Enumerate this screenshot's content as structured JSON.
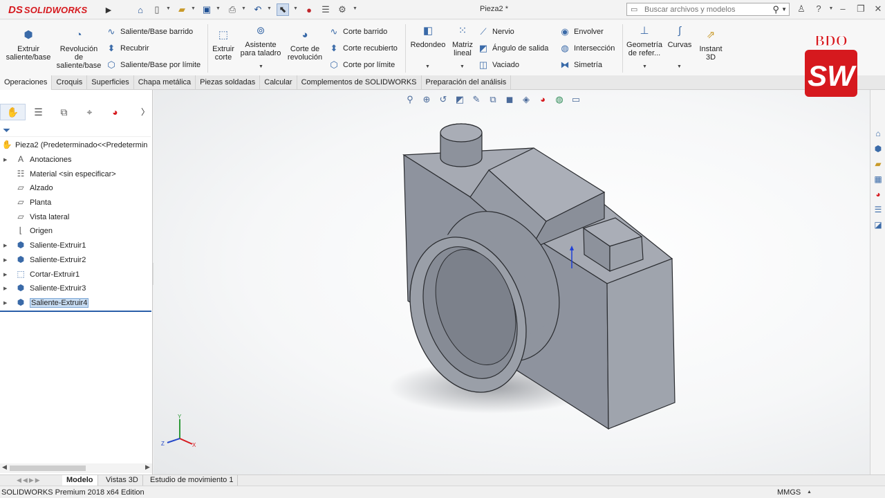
{
  "app": {
    "logo_ds": "DS",
    "logo_name": "SOLIDWORKS",
    "document_title": "Pieza2 *",
    "search_placeholder": "Buscar archivos y modelos"
  },
  "toolbar": {
    "extrude_boss": "Extruir saliente/base",
    "revolve_boss": "Revolución de saliente/base",
    "swept_boss": "Saliente/Base barrido",
    "loft": "Recubrir",
    "boundary_boss": "Saliente/Base por límite",
    "extrude_cut": "Extruir corte",
    "hole_wizard": "Asistente para taladro",
    "revolve_cut": "Corte de revolución",
    "swept_cut": "Corte barrido",
    "lofted_cut": "Corte recubierto",
    "boundary_cut": "Corte por límite",
    "fillet": "Redondeo",
    "linear_pattern": "Matriz lineal",
    "rib": "Nervio",
    "draft": "Ángulo de salida",
    "shell": "Vaciado",
    "wrap": "Envolver",
    "intersect": "Intersección",
    "mirror": "Simetría",
    "reference_geometry": "Geometría de refer...",
    "curves": "Curvas",
    "instant3d": "Instant 3D"
  },
  "tabs": [
    "Operaciones",
    "Croquis",
    "Superficies",
    "Chapa metálica",
    "Piezas soldadas",
    "Calcular",
    "Complementos de SOLIDWORKS",
    "Preparación del análisis"
  ],
  "tree": {
    "root": "Pieza2  (Predeterminado<<Predetermin",
    "items": [
      {
        "label": "Anotaciones",
        "icon": "annotations-icon"
      },
      {
        "label": "Material <sin especificar>",
        "icon": "material-icon"
      },
      {
        "label": "Alzado",
        "icon": "plane-icon"
      },
      {
        "label": "Planta",
        "icon": "plane-icon"
      },
      {
        "label": "Vista lateral",
        "icon": "plane-icon"
      },
      {
        "label": "Origen",
        "icon": "origin-icon"
      },
      {
        "label": "Saliente-Extruir1",
        "icon": "extrude-feature-icon"
      },
      {
        "label": "Saliente-Extruir2",
        "icon": "extrude-feature-icon"
      },
      {
        "label": "Cortar-Extruir1",
        "icon": "cut-feature-icon"
      },
      {
        "label": "Saliente-Extruir3",
        "icon": "extrude-feature-icon"
      },
      {
        "label": "Saliente-Extruir4",
        "icon": "extrude-feature-icon"
      }
    ]
  },
  "bottom_tabs": [
    "Modelo",
    "Vistas 3D",
    "Estudio de movimiento 1"
  ],
  "status": {
    "edition": "SOLIDWORKS Premium 2018 x64 Edition",
    "units": "MMGS"
  },
  "triad": {
    "x": "X",
    "y": "Y",
    "z": "Z"
  },
  "watermark": {
    "top": "BDO",
    "bottom": "SW"
  },
  "colors": {
    "brand_red": "#d6191e",
    "model_gray": "#8e939e",
    "selection_blue": "#2a5ea8"
  }
}
